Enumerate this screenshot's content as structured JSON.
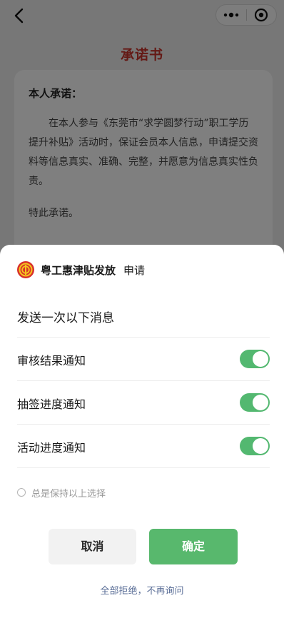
{
  "background_page": {
    "title": "承诺书",
    "card": {
      "heading": "本人承诺：",
      "body": "在本人参与《东莞市“求学圆梦行动”职工学历提升补贴》活动时，保证会员本人信息，申请提交资料等信息真实、准确、完整，并愿意为信息真实性负责。",
      "closing": "特此承诺。"
    }
  },
  "colors": {
    "title_red": "#c8332b",
    "toggle_green": "#53b870",
    "confirm_green": "#58b86d",
    "link_blue": "#576b95"
  },
  "dialog": {
    "app_name": "粤工惠津贴发放",
    "action": "申请",
    "send_title": "发送一次以下消息",
    "notifications": [
      {
        "label": "审核结果通知",
        "enabled": true
      },
      {
        "label": "抽签进度通知",
        "enabled": true
      },
      {
        "label": "活动进度通知",
        "enabled": true
      }
    ],
    "keep_choice_label": "总是保持以上选择",
    "cancel_label": "取消",
    "confirm_label": "确定",
    "reject_all_label": "全部拒绝，不再询问"
  }
}
